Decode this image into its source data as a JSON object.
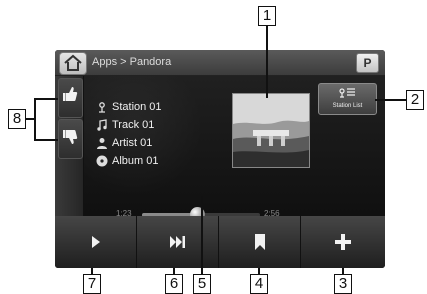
{
  "header": {
    "breadcrumb": "Apps > Pandora",
    "p_button_label": "P"
  },
  "track_info": {
    "station": "Station 01",
    "track": "Track 01",
    "artist": "Artist 01",
    "album": "Album 01"
  },
  "station_list_label": "Station List",
  "progress": {
    "elapsed": "1:23",
    "total": "2:56",
    "fraction": 0.47
  },
  "controls": {
    "icons": [
      "play-icon",
      "skip-forward-icon",
      "bookmark-icon",
      "plus-icon"
    ]
  },
  "callouts": [
    "1",
    "2",
    "3",
    "4",
    "5",
    "6",
    "7",
    "8"
  ]
}
